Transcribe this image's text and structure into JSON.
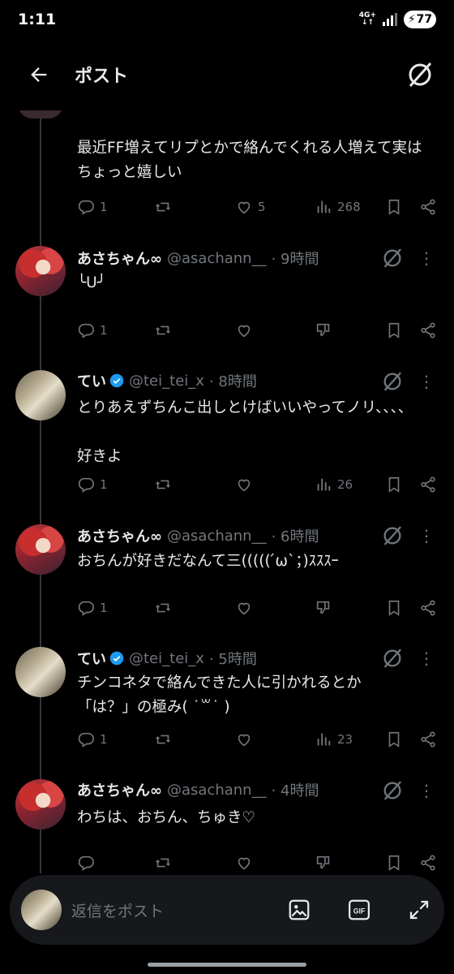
{
  "status": {
    "time": "1:11",
    "network": "4G+",
    "battery": "77"
  },
  "header": {
    "title": "ポスト"
  },
  "first_post": {
    "text": "最近FF増えてリプとかで絡んでくれる人増えて実はちょっと嬉しい",
    "replies": "1",
    "likes": "5",
    "views": "268"
  },
  "posts": [
    {
      "name": "あさちゃん∞",
      "handle": "@asachann__",
      "time": "· 9時間",
      "text": "╰U╯",
      "replies": "1",
      "likes": "",
      "views": ""
    },
    {
      "name": "てい",
      "handle": "@tei_tei_x",
      "time": "· 8時間",
      "text": "とりあえずちんこ出しとけばいいやってノリ、、、、\n\n好きよ",
      "replies": "1",
      "likes": "",
      "views": "26"
    },
    {
      "name": "あさちゃん∞",
      "handle": "@asachann__",
      "time": "· 6時間",
      "text": "おちんが好きだなんて三((((( ́ω`；)ｽｽｽｰ",
      "replies": "1",
      "likes": "",
      "views": ""
    },
    {
      "name": "てい",
      "handle": "@tei_tei_x",
      "time": "· 5時間",
      "text": "チンコネタで絡んできた人に引かれるとか\n「は？」の極み( ˙꒳​˙ )",
      "replies": "1",
      "likes": "",
      "views": "23"
    },
    {
      "name": "あさちゃん∞",
      "handle": "@asachann__",
      "time": "· 4時間",
      "text": "わちは、おちん、ちゅき♡",
      "replies": "",
      "likes": "",
      "views": ""
    }
  ],
  "reply_bar": {
    "placeholder": "返信をポスト",
    "gif_label": "GIF"
  },
  "colors": {
    "background": "#000000",
    "text": "#e7e9ea",
    "muted": "#71767b",
    "verified": "#1d9bf0"
  }
}
